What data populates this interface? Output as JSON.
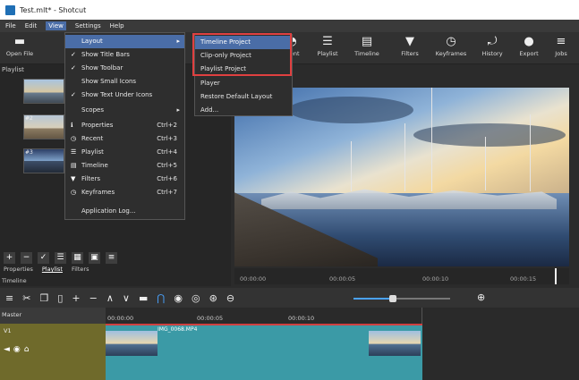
{
  "window": {
    "title": "Test.mlt* - Shotcut"
  },
  "menubar": {
    "items": [
      "File",
      "Edit",
      "View",
      "Settings",
      "Help"
    ],
    "active": "View"
  },
  "toolbar": {
    "open_file": "Open File",
    "buttons": [
      "…ent",
      "Playlist",
      "Timeline",
      "Filters",
      "Keyframes",
      "History",
      "Export",
      "Jobs"
    ]
  },
  "playlist": {
    "label": "Playlist",
    "thumb_labels": [
      "#2",
      "#3"
    ],
    "tabs": [
      "Properties",
      "Playlist",
      "Filters"
    ]
  },
  "timeline": {
    "label": "Timeline",
    "master": "Master",
    "track": "V1",
    "clip_name": "IMG_0068.MP4",
    "ruler": [
      "00:00:00",
      "00:00:05",
      "00:00:10"
    ]
  },
  "player_ruler": [
    "00:00:00",
    "00:00:05",
    "00:00:10",
    "00:00:15"
  ],
  "view_menu": [
    {
      "label": "Layout",
      "check": false,
      "submenu": true,
      "highlighted": true
    },
    {
      "label": "Show Title Bars",
      "check": true
    },
    {
      "label": "Show Toolbar",
      "check": true
    },
    {
      "label": "Show Small Icons",
      "check": false
    },
    {
      "label": "Show Text Under Icons",
      "check": true
    },
    {
      "label": "Scopes",
      "check": false,
      "submenu": true
    },
    {
      "label": "Properties",
      "shortcut": "Ctrl+2",
      "icon": "info-icon"
    },
    {
      "label": "Recent",
      "shortcut": "Ctrl+3",
      "icon": "clock-icon"
    },
    {
      "label": "Playlist",
      "shortcut": "Ctrl+4",
      "icon": "list-icon"
    },
    {
      "label": "Timeline",
      "shortcut": "Ctrl+5",
      "icon": "timeline-icon"
    },
    {
      "label": "Filters",
      "shortcut": "Ctrl+6",
      "icon": "filter-icon"
    },
    {
      "label": "Keyframes",
      "shortcut": "Ctrl+7",
      "icon": "stopwatch-icon"
    },
    {
      "label": "Application Log...",
      "check": false
    }
  ],
  "layout_submenu": [
    "Timeline Project",
    "Clip-only Project",
    "Playlist Project",
    "Player",
    "Restore Default Layout",
    "Add..."
  ]
}
